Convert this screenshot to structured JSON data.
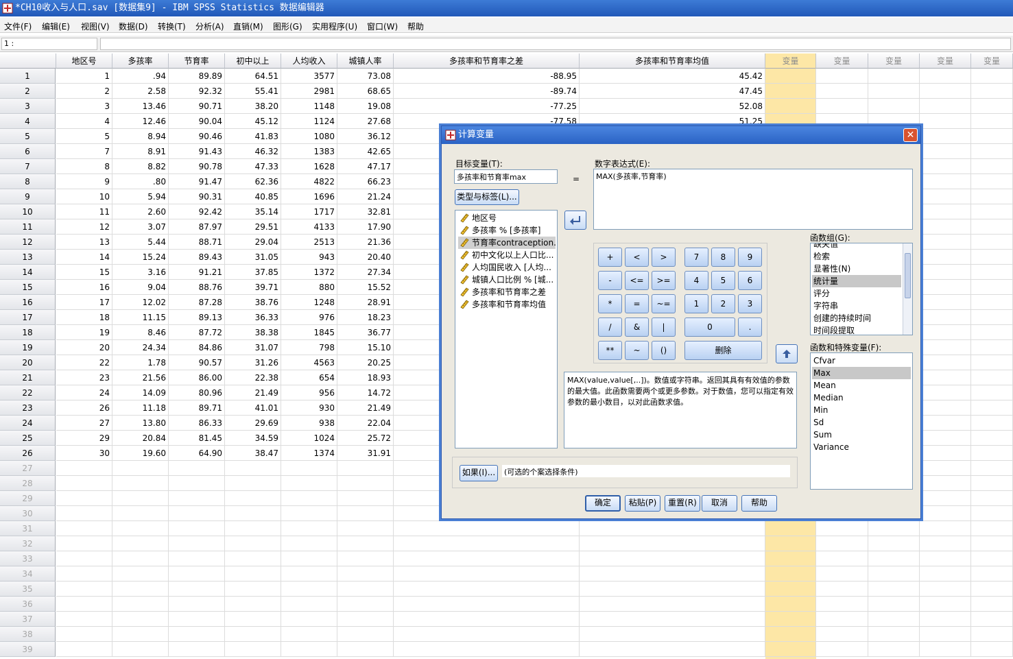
{
  "window": {
    "title": "*CH10收入与人口.sav [数据集9] - IBM SPSS Statistics 数据编辑器"
  },
  "menu": [
    "文件(F)",
    "编辑(E)",
    "视图(V)",
    "数据(D)",
    "转换(T)",
    "分析(A)",
    "直销(M)",
    "图形(G)",
    "实用程序(U)",
    "窗口(W)",
    "帮助"
  ],
  "cell_ref": "1 :",
  "grid": {
    "columns": [
      "地区号",
      "多孩率",
      "节育率",
      "初中以上",
      "人均收入",
      "城镇人率",
      "多孩率和节育率之差",
      "多孩率和节育率均值",
      "变量",
      "变量",
      "变量",
      "变量",
      "变量"
    ],
    "rows": [
      [
        "1",
        ".94",
        "89.89",
        "64.51",
        "3577",
        "73.08",
        "-88.95",
        "45.42"
      ],
      [
        "2",
        "2.58",
        "92.32",
        "55.41",
        "2981",
        "68.65",
        "-89.74",
        "47.45"
      ],
      [
        "3",
        "13.46",
        "90.71",
        "38.20",
        "1148",
        "19.08",
        "-77.25",
        "52.08"
      ],
      [
        "4",
        "12.46",
        "90.04",
        "45.12",
        "1124",
        "27.68",
        "-77.58",
        "51.25"
      ],
      [
        "5",
        "8.94",
        "90.46",
        "41.83",
        "1080",
        "36.12",
        "",
        ""
      ],
      [
        "7",
        "8.91",
        "91.43",
        "46.32",
        "1383",
        "42.65",
        "",
        ""
      ],
      [
        "8",
        "8.82",
        "90.78",
        "47.33",
        "1628",
        "47.17",
        "",
        ""
      ],
      [
        "9",
        ".80",
        "91.47",
        "62.36",
        "4822",
        "66.23",
        "",
        ""
      ],
      [
        "10",
        "5.94",
        "90.31",
        "40.85",
        "1696",
        "21.24",
        "",
        ""
      ],
      [
        "11",
        "2.60",
        "92.42",
        "35.14",
        "1717",
        "32.81",
        "",
        ""
      ],
      [
        "12",
        "3.07",
        "87.97",
        "29.51",
        "4133",
        "17.90",
        "",
        ""
      ],
      [
        "13",
        "5.44",
        "88.71",
        "29.04",
        "2513",
        "21.36",
        "",
        ""
      ],
      [
        "14",
        "15.24",
        "89.43",
        "31.05",
        "943",
        "20.40",
        "",
        ""
      ],
      [
        "15",
        "3.16",
        "91.21",
        "37.85",
        "1372",
        "27.34",
        "",
        ""
      ],
      [
        "16",
        "9.04",
        "88.76",
        "39.71",
        "880",
        "15.52",
        "",
        ""
      ],
      [
        "17",
        "12.02",
        "87.28",
        "38.76",
        "1248",
        "28.91",
        "",
        ""
      ],
      [
        "18",
        "11.15",
        "89.13",
        "36.33",
        "976",
        "18.23",
        "",
        ""
      ],
      [
        "19",
        "8.46",
        "87.72",
        "38.38",
        "1845",
        "36.77",
        "",
        ""
      ],
      [
        "20",
        "24.34",
        "84.86",
        "31.07",
        "798",
        "15.10",
        "",
        ""
      ],
      [
        "22",
        "1.78",
        "90.57",
        "31.26",
        "4563",
        "20.25",
        "",
        ""
      ],
      [
        "23",
        "21.56",
        "86.00",
        "22.38",
        "654",
        "18.93",
        "",
        ""
      ],
      [
        "24",
        "14.09",
        "80.96",
        "21.49",
        "956",
        "14.72",
        "",
        ""
      ],
      [
        "26",
        "11.18",
        "89.71",
        "41.01",
        "930",
        "21.49",
        "",
        ""
      ],
      [
        "27",
        "13.80",
        "86.33",
        "29.69",
        "938",
        "22.04",
        "",
        ""
      ],
      [
        "29",
        "20.84",
        "81.45",
        "34.59",
        "1024",
        "25.72",
        "",
        ""
      ],
      [
        "30",
        "19.60",
        "64.90",
        "38.47",
        "1374",
        "31.91",
        "",
        ""
      ]
    ],
    "row_numbers": [
      "1",
      "2",
      "3",
      "4",
      "5",
      "6",
      "7",
      "8",
      "9",
      "10",
      "11",
      "12",
      "13",
      "14",
      "15",
      "16",
      "17",
      "18",
      "19",
      "20",
      "21",
      "22",
      "23",
      "24",
      "25",
      "26",
      "27",
      "28",
      "29",
      "30",
      "31",
      "32",
      "33",
      "34",
      "35",
      "36",
      "37",
      "38",
      "39"
    ]
  },
  "dialog": {
    "title": "计算变量",
    "close": "✕",
    "target_label": "目标变量(T):",
    "target_value": "多孩率和节育率max",
    "equals": "=",
    "type_label_button": "类型与标签(L)...",
    "expr_label": "数字表达式(E):",
    "expr_value": "MAX(多孩率,节育率)",
    "variables": [
      "地区号",
      "多孩率 % [多孩率]",
      "节育率contraception...",
      "初中文化以上人口比...",
      "人均国民收入 [人均...",
      "城镇人口比例 % [城...",
      "多孩率和节育率之差",
      "多孩率和节育率均值"
    ],
    "selected_variable_index": 2,
    "calc_keys": [
      "+",
      "<",
      ">",
      "7",
      "8",
      "9",
      "-",
      "<=",
      ">=",
      "4",
      "5",
      "6",
      "*",
      "=",
      "~=",
      "1",
      "2",
      "3",
      "/",
      "&",
      "|",
      "0",
      ".",
      "**",
      "~",
      "()",
      "删除"
    ],
    "function_group_label": "函数组(G):",
    "function_groups": [
      "缺失值",
      "检索",
      "显著性(N)",
      "统计量",
      "评分",
      "字符串",
      "创建的持续时间",
      "时间段提取"
    ],
    "selected_group": "统计量",
    "functions_label": "函数和特殊变量(F):",
    "functions": [
      "Cfvar",
      "Max",
      "Mean",
      "Median",
      "Min",
      "Sd",
      "Sum",
      "Variance"
    ],
    "selected_function": "Max",
    "description": "MAX(value,value[,..])。数值或字符串。返回其具有有效值的参数的最大值。此函数需要两个或更多参数。对于数值，您可以指定有效参数的最小数目，以对此函数求值。",
    "if_button": "如果(I)...",
    "if_text": "(可选的个案选择条件)",
    "buttons": {
      "ok": "确定",
      "paste": "粘贴(P)",
      "reset": "重置(R)",
      "cancel": "取消",
      "help": "帮助"
    }
  }
}
